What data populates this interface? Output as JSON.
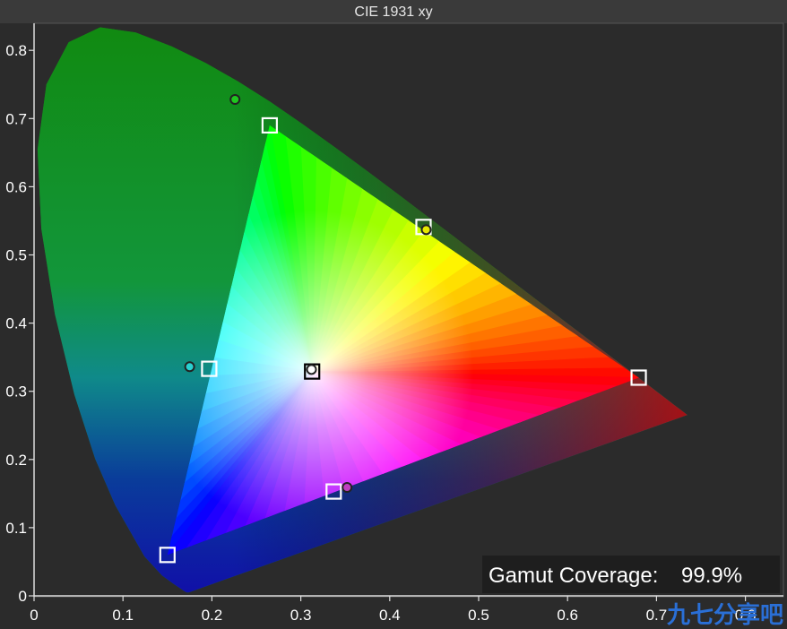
{
  "chart_data": {
    "type": "scatter",
    "title": "CIE 1931 xy",
    "xlim": [
      0,
      0.8
    ],
    "ylim": [
      0,
      0.85
    ],
    "x_ticks": [
      0,
      0.1,
      0.2,
      0.3,
      0.4,
      0.5,
      0.6,
      0.7,
      0.8
    ],
    "x_tick_labels": [
      "0",
      "0.1",
      "0.2",
      "0.3",
      "0.4",
      "0.5",
      "0.6",
      "0.7",
      "0.8"
    ],
    "y_ticks": [
      0,
      0.1,
      0.2,
      0.3,
      0.4,
      0.5,
      0.6,
      0.7,
      0.8
    ],
    "y_tick_labels": [
      "0",
      "0.1",
      "0.2",
      "0.3",
      "0.4",
      "0.5",
      "0.6",
      "0.7",
      "0.8"
    ],
    "grid": false,
    "spectral_locus": [
      [
        0.1741,
        0.005
      ],
      [
        0.1738,
        0.0049
      ],
      [
        0.1736,
        0.0049
      ],
      [
        0.1733,
        0.0048
      ],
      [
        0.1726,
        0.0048
      ],
      [
        0.1714,
        0.0051
      ],
      [
        0.1689,
        0.0069
      ],
      [
        0.1644,
        0.0109
      ],
      [
        0.1566,
        0.0177
      ],
      [
        0.144,
        0.0297
      ],
      [
        0.1241,
        0.0578
      ],
      [
        0.0913,
        0.1327
      ],
      [
        0.0687,
        0.2007
      ],
      [
        0.0454,
        0.295
      ],
      [
        0.0235,
        0.4127
      ],
      [
        0.0082,
        0.5384
      ],
      [
        0.0039,
        0.6548
      ],
      [
        0.0139,
        0.7502
      ],
      [
        0.0389,
        0.812
      ],
      [
        0.0743,
        0.8338
      ],
      [
        0.1142,
        0.8262
      ],
      [
        0.1547,
        0.8059
      ],
      [
        0.1929,
        0.7816
      ],
      [
        0.2296,
        0.7543
      ],
      [
        0.2658,
        0.7243
      ],
      [
        0.3016,
        0.6923
      ],
      [
        0.3373,
        0.6589
      ],
      [
        0.3731,
        0.6245
      ],
      [
        0.4087,
        0.5896
      ],
      [
        0.4441,
        0.5547
      ],
      [
        0.4788,
        0.5202
      ],
      [
        0.5125,
        0.4866
      ],
      [
        0.5448,
        0.4544
      ],
      [
        0.5752,
        0.4242
      ],
      [
        0.6029,
        0.3965
      ],
      [
        0.627,
        0.3725
      ],
      [
        0.6482,
        0.3514
      ],
      [
        0.6658,
        0.334
      ],
      [
        0.6801,
        0.3197
      ],
      [
        0.6915,
        0.3083
      ],
      [
        0.7006,
        0.2993
      ],
      [
        0.7079,
        0.292
      ],
      [
        0.714,
        0.2859
      ],
      [
        0.719,
        0.2809
      ],
      [
        0.723,
        0.277
      ],
      [
        0.726,
        0.274
      ],
      [
        0.7347,
        0.2653
      ]
    ],
    "target_gamut": [
      [
        0.68,
        0.32
      ],
      [
        0.265,
        0.69
      ],
      [
        0.15,
        0.06
      ]
    ],
    "series": [
      {
        "marker": "square",
        "points": [
          {
            "x": 0.68,
            "y": 0.32,
            "color": "#ff0000"
          },
          {
            "x": 0.265,
            "y": 0.69,
            "color": "#00ff00"
          },
          {
            "x": 0.15,
            "y": 0.06,
            "color": "#0000ff"
          },
          {
            "x": 0.197,
            "y": 0.333,
            "color": "#00ffff"
          },
          {
            "x": 0.337,
            "y": 0.153,
            "color": "#ff00ff"
          },
          {
            "x": 0.438,
            "y": 0.541,
            "color": "#ffff00"
          },
          {
            "x": 0.3127,
            "y": 0.329,
            "color": "#ffffff"
          }
        ]
      },
      {
        "marker": "circle",
        "points": [
          {
            "x": 0.226,
            "y": 0.728,
            "color": "#1fc71f"
          },
          {
            "x": 0.175,
            "y": 0.336,
            "color": "#2ad0d0"
          },
          {
            "x": 0.352,
            "y": 0.159,
            "color": "#c040c0"
          },
          {
            "x": 0.441,
            "y": 0.537,
            "color": "#e8e800"
          },
          {
            "x": 0.312,
            "y": 0.332,
            "color": "#ffffff"
          }
        ]
      }
    ],
    "annotation": {
      "label": "Gamut Coverage:",
      "value": "99.9%"
    }
  },
  "watermark": "九七分享吧",
  "colors": {
    "background": "#2b2b2b",
    "locus_fill": "#1a8f1a",
    "axis": "#dddddd"
  }
}
